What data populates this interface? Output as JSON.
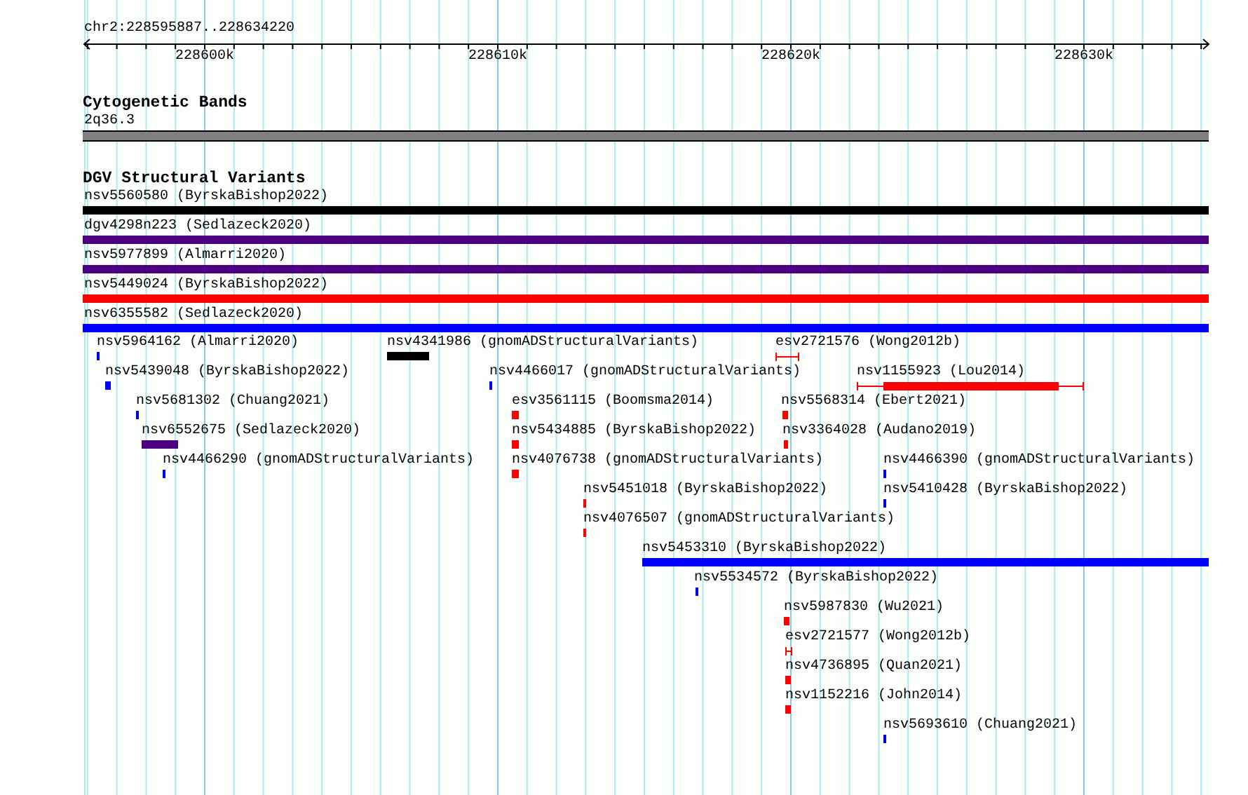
{
  "ruler": {
    "location": "chr2:228595887..228634220",
    "tick_labels": [
      "228600k",
      "228610k",
      "228620k",
      "228630k"
    ]
  },
  "cytogenetic_bands": {
    "title": "Cytogenetic Bands",
    "band": "2q36.3"
  },
  "dgv_structural_variants": {
    "title": "DGV Structural Variants",
    "spanning_variants": [
      {
        "label": "nsv5560580 (ByrskaBishop2022)",
        "color": "#000000"
      },
      {
        "label": "dgv4298n223 (Sedlazeck2020)",
        "color": "#4b0082"
      },
      {
        "label": "nsv5977899 (Almarri2020)",
        "color": "#4b0082"
      },
      {
        "label": "nsv5449024 (ByrskaBishop2022)",
        "color": "#ff0000"
      },
      {
        "label": "nsv6355582 (Sedlazeck2020)",
        "color": "#0000ff"
      }
    ],
    "variants": [
      {
        "label": "nsv5964162 (Almarri2020)",
        "color": "#0000ff",
        "kind": "bar"
      },
      {
        "label": "nsv4341986 (gnomADStructuralVariants)",
        "color": "#000000",
        "kind": "bar"
      },
      {
        "label": "esv2721576 (Wong2012b)",
        "color": "#ff0000",
        "kind": "range"
      },
      {
        "label": "nsv5439048 (ByrskaBishop2022)",
        "color": "#0000ff",
        "kind": "bar"
      },
      {
        "label": "nsv4466017 (gnomADStructuralVariants)",
        "color": "#0000ff",
        "kind": "bar"
      },
      {
        "label": "nsv1155923 (Lou2014)",
        "color": "#ff0000",
        "kind": "range"
      },
      {
        "label": "nsv5681302 (Chuang2021)",
        "color": "#0000ff",
        "kind": "bar"
      },
      {
        "label": "esv3561115 (Boomsma2014)",
        "color": "#ff0000",
        "kind": "bar"
      },
      {
        "label": "nsv5568314 (Ebert2021)",
        "color": "#ff0000",
        "kind": "bar"
      },
      {
        "label": "nsv6552675 (Sedlazeck2020)",
        "color": "#4b0082",
        "kind": "bar"
      },
      {
        "label": "nsv5434885 (ByrskaBishop2022)",
        "color": "#ff0000",
        "kind": "bar"
      },
      {
        "label": "nsv3364028 (Audano2019)",
        "color": "#ff0000",
        "kind": "bar"
      },
      {
        "label": "nsv4466290 (gnomADStructuralVariants)",
        "color": "#0000ff",
        "kind": "bar"
      },
      {
        "label": "nsv4076738 (gnomADStructuralVariants)",
        "color": "#ff0000",
        "kind": "bar"
      },
      {
        "label": "nsv4466390 (gnomADStructuralVariants)",
        "color": "#0000ff",
        "kind": "bar"
      },
      {
        "label": "nsv5451018 (ByrskaBishop2022)",
        "color": "#ff0000",
        "kind": "bar"
      },
      {
        "label": "nsv5410428 (ByrskaBishop2022)",
        "color": "#0000ff",
        "kind": "bar"
      },
      {
        "label": "nsv4076507 (gnomADStructuralVariants)",
        "color": "#ff0000",
        "kind": "bar"
      },
      {
        "label": "nsv5453310 (ByrskaBishop2022)",
        "color": "#0000ff",
        "kind": "bar"
      },
      {
        "label": "nsv5534572 (ByrskaBishop2022)",
        "color": "#0000ff",
        "kind": "bar"
      },
      {
        "label": "nsv5987830 (Wu2021)",
        "color": "#ff0000",
        "kind": "bar"
      },
      {
        "label": "esv2721577 (Wong2012b)",
        "color": "#ff0000",
        "kind": "range"
      },
      {
        "label": "nsv4736895 (Quan2021)",
        "color": "#ff0000",
        "kind": "bar"
      },
      {
        "label": "nsv1152216 (John2014)",
        "color": "#ff0000",
        "kind": "bar"
      },
      {
        "label": "nsv5693610 (Chuang2021)",
        "color": "#0000ff",
        "kind": "bar"
      }
    ]
  }
}
